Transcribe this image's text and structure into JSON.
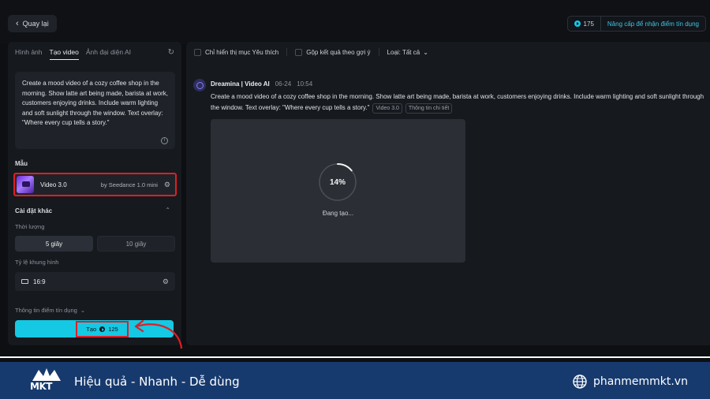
{
  "topbar": {
    "back_label": "Quay lại",
    "credits": "175",
    "upgrade_label": "Nâng cấp để nhận điểm tín dụng"
  },
  "left": {
    "tabs": [
      "Hình ảnh",
      "Tạo video",
      "Ảnh đại diện AI"
    ],
    "active_tab": "Tạo video",
    "prompt": "Create a mood video of a cozy coffee shop in the morning. Show latte art being made, barista at work, customers enjoying drinks. Include warm lighting and soft sunlight through the window. Text overlay: \"Where every cup tells a story.\"",
    "model_section": "Mẫu",
    "model_name": "Video 3.0",
    "model_by": "by Seedance 1.0 mini",
    "other_settings": "Cài đặt khác",
    "duration_label": "Thời lượng",
    "duration_options": [
      "5 giây",
      "10 giây"
    ],
    "selected_duration": "5 giây",
    "ratio_label": "Tỷ lệ khung hình",
    "ratio_value": "16:9",
    "credit_info": "Thông tin điểm tín dụng",
    "create_label": "Tạo",
    "create_cost": "125"
  },
  "right": {
    "filter_favorites": "Chỉ hiển thị mục Yêu thích",
    "filter_group": "Gộp kết quả theo gợi ý",
    "filter_type": "Loại: Tất cả",
    "gen_source": "Dreamina | Video AI",
    "gen_date": "06-24",
    "gen_time": "10:54",
    "gen_prompt_line1": "Create a mood video of a cozy coffee shop in the morning. Show latte art being made, barista at work, customers enjoying drinks. Include warm lighting and soft sunlight through",
    "gen_prompt_line2": "the window. Text overlay: \"Where every cup tells a story.\"",
    "tag_model": "Video 3.0",
    "tag_details": "Thông tin chi tiết",
    "progress_text": "14%",
    "progress_value": 0.14,
    "loading_label": "Đang tạo..."
  },
  "footer": {
    "logo_text": "MKT",
    "tagline": "Hiệu quả - Nhanh - Dễ dùng",
    "site": "phanmemmkt.vn"
  },
  "colors": {
    "accent": "#15c8e3",
    "highlight": "#e01e24",
    "footer_bg": "#173a6e"
  }
}
